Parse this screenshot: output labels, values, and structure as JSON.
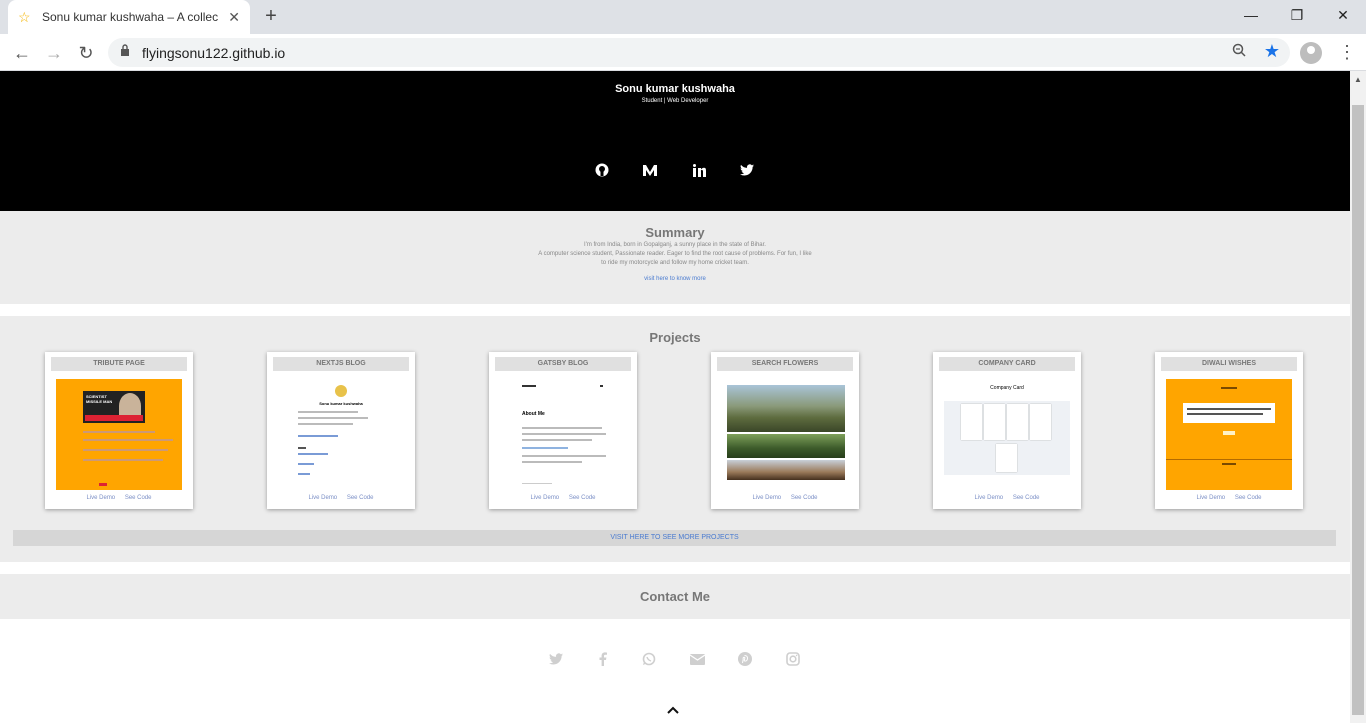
{
  "browser": {
    "tab_title": "Sonu kumar kushwaha – A collec",
    "url": "flyingsonu122.github.io",
    "icons": [
      "star-icon",
      "close-icon",
      "new-tab-icon",
      "back-icon",
      "forward-icon",
      "reload-icon",
      "lock-icon",
      "zoom-icon",
      "bookmark-star-icon",
      "profile-icon",
      "menu-icon"
    ]
  },
  "hero": {
    "name": "Sonu kumar kushwaha",
    "role": "Student | Web Developer",
    "social": [
      "github-icon",
      "medium-icon",
      "linkedin-icon",
      "twitter-icon"
    ]
  },
  "summary": {
    "heading": "Summary",
    "line1": "I'm from India, born in Gopalganj, a sunny place in the state of Bihar.",
    "line2": "A computer science student, Passionate reader. Eager to find the root cause of problems. For fun, I like",
    "line3": "to ride my motorcycle and follow my home cricket team.",
    "more_link": "visit here to know more"
  },
  "projects": {
    "heading": "Projects",
    "live_label": "Live Demo",
    "code_label": "See Code",
    "cards": [
      {
        "title": "TRIBUTE PAGE"
      },
      {
        "title": "NEXTJS BLOG"
      },
      {
        "title": "GATSBY BLOG"
      },
      {
        "title": "SEARCH FLOWERS"
      },
      {
        "title": "COMPANY CARD"
      },
      {
        "title": "DIWALI WISHES"
      }
    ],
    "more_link": "VISIT HERE TO SEE MORE PROJECTS",
    "thumb_text": {
      "nextjs_name": "Sonu kumar kushwaha",
      "gatsby_about": "About Me",
      "company_title": "Company Card",
      "tribute_banner": "SCIENTIST MISSILE MAN"
    }
  },
  "contact": {
    "heading": "Contact Me",
    "icons": [
      "twitter-icon",
      "facebook-icon",
      "whatsapp-icon",
      "email-icon",
      "pinterest-icon",
      "instagram-icon"
    ]
  },
  "colors": {
    "hero_bg": "#000000",
    "section_bg": "#ececec",
    "link": "#4a7bd0",
    "orange": "#ffa500"
  }
}
